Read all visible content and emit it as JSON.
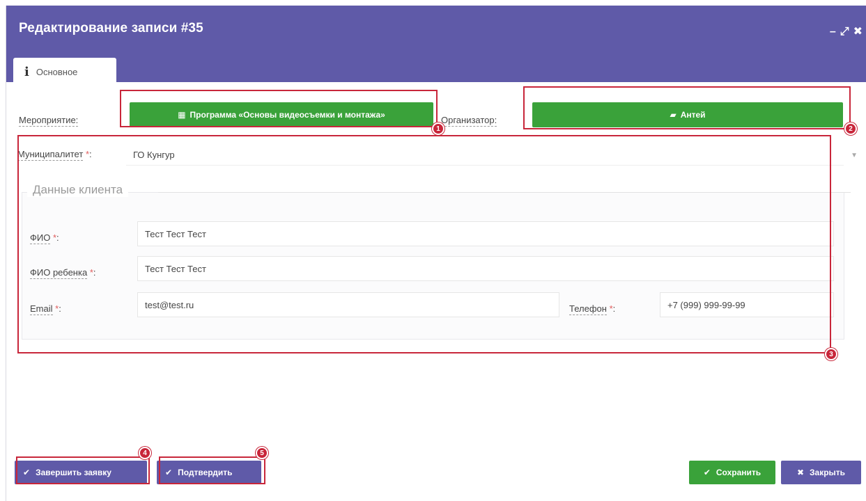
{
  "window": {
    "title": "Редактирование записи #35",
    "controls": {
      "minimize": "–",
      "maximize": "⤢",
      "close": "✖"
    }
  },
  "tabs": [
    {
      "icon": "i",
      "label": "Основное"
    }
  ],
  "event": {
    "label": "Мероприятие:",
    "button": "Программа «Основы видеосъемки и монтажа»"
  },
  "organizer": {
    "label": "Организатор:",
    "button": "Антей"
  },
  "municipality": {
    "label": "Муниципалитет",
    "required": "*",
    "colon": ":",
    "value": "ГО Кунгур"
  },
  "client": {
    "legend": "Данные клиента",
    "fio": {
      "label": "ФИО",
      "required": "*",
      "value": "Тест Тест Тест"
    },
    "child_fio": {
      "label": "ФИО ребенка",
      "required": "*",
      "value": "Тест Тест Тест"
    },
    "email": {
      "label": "Email",
      "required": "*",
      "value": "test@test.ru"
    },
    "phone": {
      "label": "Телефон",
      "required": "*",
      "value": "+7 (999) 999-99-99"
    }
  },
  "callouts": [
    "1",
    "2",
    "3",
    "4",
    "5"
  ],
  "footer": {
    "finish_label": "Завершить заявку",
    "confirm_label": "Подтвердить",
    "save_label": "Сохранить",
    "close_label": "Закрыть"
  },
  "colors": {
    "header": "#5f5aa8",
    "green": "#3aa23a",
    "callout_red": "#c8263a"
  }
}
